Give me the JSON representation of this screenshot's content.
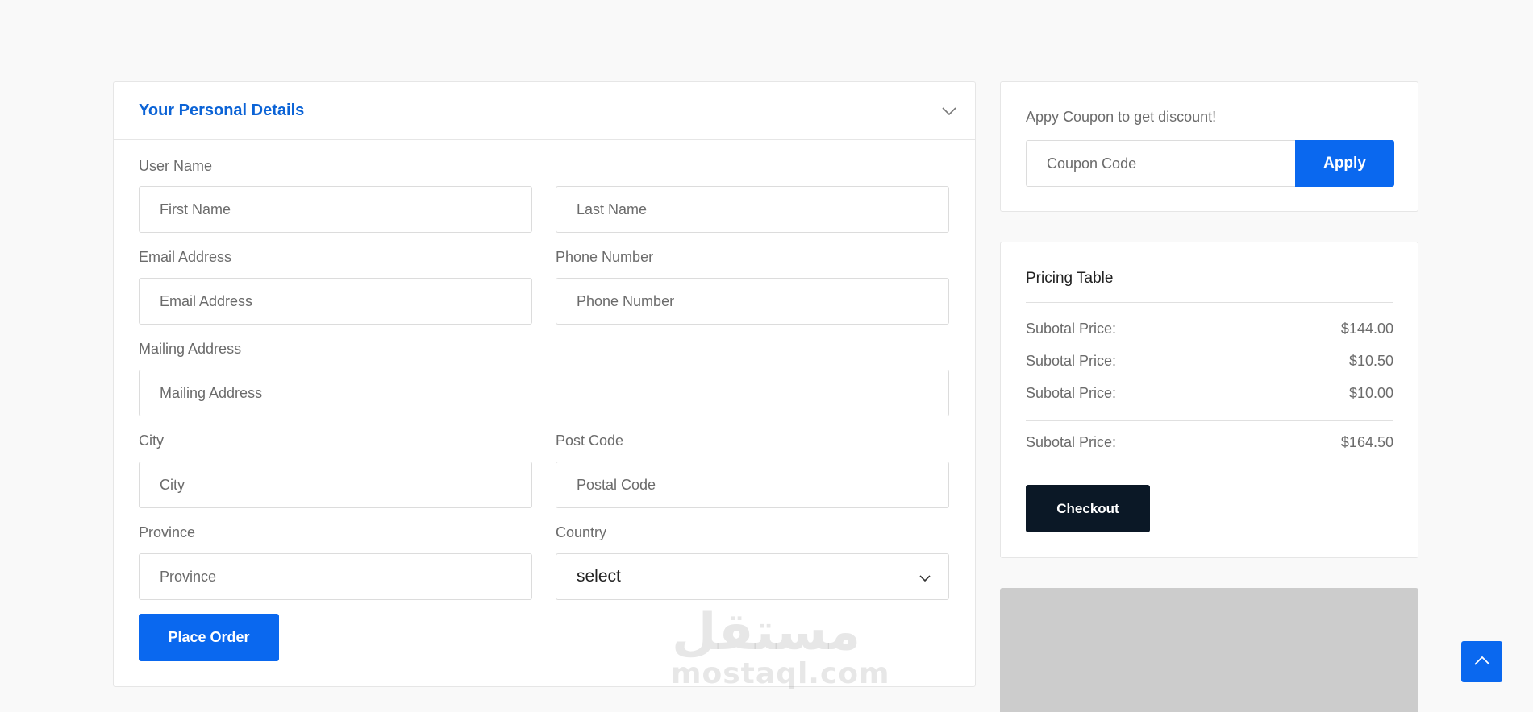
{
  "details": {
    "title": "Your Personal Details",
    "toggle_icon": "chevron-down-icon",
    "labels": {
      "user_name": "User Name",
      "email": "Email Address",
      "phone": "Phone Number",
      "mailing": "Mailing Address",
      "city": "City",
      "post_code": "Post Code",
      "province": "Province",
      "country": "Country"
    },
    "placeholders": {
      "first_name": "First Name",
      "last_name": "Last Name",
      "email": "Email Address",
      "phone": "Phone Number",
      "mailing": "Mailing Address",
      "city": "City",
      "postal": "Postal Code",
      "province": "Province"
    },
    "country_selected": "select",
    "place_order_label": "Place Order"
  },
  "coupon": {
    "text": "Appy Coupon to get discount!",
    "placeholder": "Coupon Code",
    "apply_label": "Apply"
  },
  "pricing": {
    "title": "Pricing Table",
    "rows": [
      {
        "label": "Subotal Price:",
        "value": "$144.00"
      },
      {
        "label": "Subotal Price:",
        "value": "$10.50"
      },
      {
        "label": "Subotal Price:",
        "value": "$10.00"
      }
    ],
    "total": {
      "label": "Subotal Price:",
      "value": "$164.50"
    },
    "checkout_label": "Checkout"
  },
  "watermark": {
    "arabic": "مستقل",
    "latin": "mostaql.com"
  },
  "colors": {
    "primary": "#0a68ef",
    "title_blue": "#0b63d6",
    "dark": "#0b1826",
    "page_bg": "#f9f9f9"
  }
}
